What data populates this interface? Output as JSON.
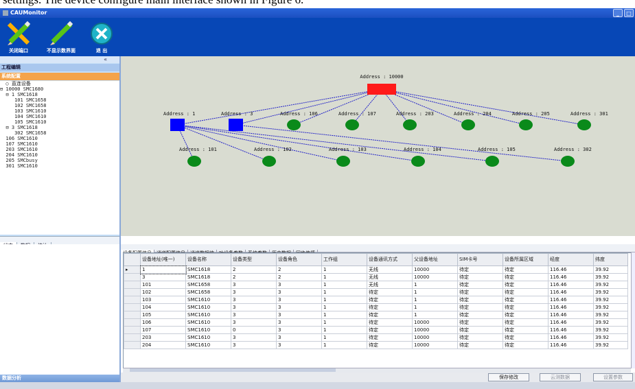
{
  "caption": "settings. The device configure main interface shown in Figure 6.",
  "window": {
    "title": "CAUMonitor"
  },
  "toolbar": {
    "buttons": [
      {
        "label": "关闭端口",
        "icon": "pencil-icon"
      },
      {
        "label": "不显示数界面",
        "icon": "pencil-icon"
      },
      {
        "label": "退 出",
        "icon": "close-icon"
      }
    ]
  },
  "left_panel": {
    "collapse_symbol": "«",
    "section_project": "工程编辑",
    "section_system": "系统配置",
    "tree": [
      "  ○ 直连设备",
      "⊟ 10000 SMC1680",
      "  ⊟ 1 SMC1618",
      "     101 SMC1658",
      "     102 SMC1658",
      "     103 SMC1610",
      "     104 SMC1610",
      "     105 SMC1610",
      "  ⊟ 3 SMC1618",
      "     302 SMC1658",
      "  106 SMC1610",
      "  107 SMC1610",
      "  203 SMC1610",
      "  204 SMC1610",
      "  205 SMCbusy",
      "  301 SMC1610"
    ],
    "tabs": [
      "状态",
      "数据",
      "统计"
    ],
    "bottom_label": "数据分析"
  },
  "graph": {
    "root": "Address : 10000",
    "level1": [
      "Address : 1",
      "Address : 3",
      "Address : 106",
      "Address : 107",
      "Address : 203",
      "Address : 204",
      "Address : 205",
      "Address : 301"
    ],
    "level2": [
      "Address : 101",
      "Address : 102",
      "Address : 103",
      "Address : 104",
      "Address : 105",
      "Address : 302"
    ],
    "colors": {
      "root": "#ff1a1a",
      "router": "#0000ff",
      "end": "#0a8a1a",
      "link": "#2020c8",
      "background": "#d9dcd1"
    }
  },
  "tabs": [
    "设备配置信息",
    "通道配置信息",
    "通道数据值",
    "叶设备参数",
    "系统参数",
    "历史数据",
    "同步传感"
  ],
  "table": {
    "columns": [
      "设备地址(唯一)",
      "设备名称",
      "设备类型",
      "设备角色",
      "工作组",
      "设备通讯方式",
      "父设备地址",
      "SIM卡号",
      "设备所属区域",
      "经度",
      "纬度"
    ],
    "rows": [
      [
        "1",
        "SMC1618",
        "2",
        "2",
        "1",
        "无线",
        "10000",
        "待定",
        "待定",
        "116.46",
        "39.92"
      ],
      [
        "3",
        "SMC1618",
        "2",
        "2",
        "1",
        "无线",
        "10000",
        "待定",
        "待定",
        "116.46",
        "39.92"
      ],
      [
        "101",
        "SMC1658",
        "3",
        "3",
        "1",
        "无线",
        "1",
        "待定",
        "待定",
        "116.46",
        "39.92"
      ],
      [
        "102",
        "SMC1658",
        "3",
        "3",
        "1",
        "待定",
        "1",
        "待定",
        "待定",
        "116.46",
        "39.92"
      ],
      [
        "103",
        "SMC1610",
        "3",
        "3",
        "1",
        "待定",
        "1",
        "待定",
        "待定",
        "116.46",
        "39.92"
      ],
      [
        "104",
        "SMC1610",
        "3",
        "3",
        "1",
        "待定",
        "1",
        "待定",
        "待定",
        "116.46",
        "39.92"
      ],
      [
        "105",
        "SMC1610",
        "3",
        "3",
        "1",
        "待定",
        "1",
        "待定",
        "待定",
        "116.46",
        "39.92"
      ],
      [
        "106",
        "SMC1610",
        "3",
        "3",
        "1",
        "待定",
        "10000",
        "待定",
        "待定",
        "116.46",
        "39.92"
      ],
      [
        "107",
        "SMC1610",
        "0",
        "3",
        "1",
        "待定",
        "10000",
        "待定",
        "待定",
        "116.46",
        "39.92"
      ],
      [
        "203",
        "SMC1610",
        "3",
        "3",
        "1",
        "待定",
        "10000",
        "待定",
        "待定",
        "116.46",
        "39.92"
      ],
      [
        "204",
        "SMC1610",
        "3",
        "3",
        "1",
        "待定",
        "10000",
        "待定",
        "待定",
        "116.46",
        "39.92"
      ]
    ]
  },
  "buttons": {
    "save": "保存修改",
    "cloud": "云测数据",
    "params": "设置参数"
  }
}
